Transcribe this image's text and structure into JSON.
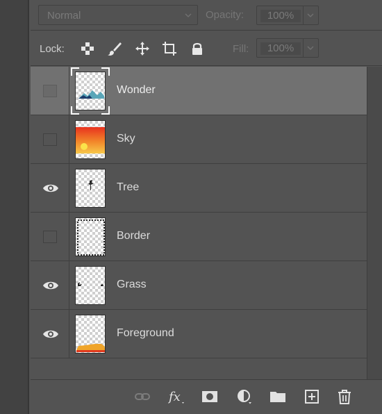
{
  "toolbar": {
    "blend_mode": "Normal",
    "opacity_label": "Opacity:",
    "opacity_value": "100%",
    "lock_label": "Lock:",
    "fill_label": "Fill:",
    "fill_value": "100%"
  },
  "layers": [
    {
      "name": "Wonder",
      "visible": false,
      "selected": true,
      "thumb": "mountain"
    },
    {
      "name": "Sky",
      "visible": false,
      "selected": false,
      "thumb": "sunset"
    },
    {
      "name": "Tree",
      "visible": true,
      "selected": false,
      "thumb": "tree"
    },
    {
      "name": "Border",
      "visible": false,
      "selected": false,
      "thumb": "border"
    },
    {
      "name": "Grass",
      "visible": true,
      "selected": false,
      "thumb": "grass"
    },
    {
      "name": "Foreground",
      "visible": true,
      "selected": false,
      "thumb": "foreground"
    }
  ],
  "bottom_icons": [
    "link-icon",
    "fx-icon",
    "mask-icon",
    "adjustment-icon",
    "folder-icon",
    "new-layer-icon",
    "trash-icon"
  ],
  "colors": {
    "panel": "#535353",
    "selected_row": "#717171",
    "text": "#dcdcdc",
    "dim_text": "#767676"
  }
}
